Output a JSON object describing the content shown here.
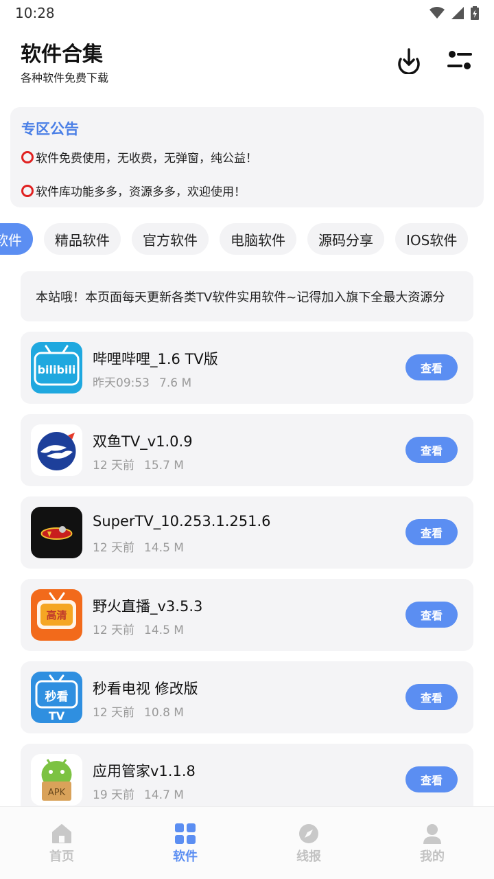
{
  "status_bar": {
    "time": "10:28"
  },
  "header": {
    "title": "软件合集",
    "subtitle": "各种软件免费下载"
  },
  "notice": {
    "title": "专区公告",
    "lines": [
      "软件免费使用，无收费，无弹窗，纯公益！",
      "软件库功能多多，资源多多，欢迎使用！"
    ]
  },
  "tabs": [
    "视软件",
    "精品软件",
    "官方软件",
    "电脑软件",
    "源码分享",
    "IOS软件"
  ],
  "marquee": {
    "text": "本站哦！本页面每天更新各类TV软件实用软件~记得加入旗下全最大资源分"
  },
  "apps": [
    {
      "name": "哔哩哔哩_1.6 TV版",
      "date": "昨天09:53",
      "size": "7.6 M",
      "button": "查看",
      "icon_text": "bilibili"
    },
    {
      "name": "双鱼TV_v1.0.9",
      "date": "12 天前",
      "size": "15.7 M",
      "button": "查看"
    },
    {
      "name": "SuperTV_10.253.1.251.6",
      "date": "12 天前",
      "size": "14.5 M",
      "button": "查看"
    },
    {
      "name": "野火直播_v3.5.3",
      "date": "12 天前",
      "size": "14.5 M",
      "button": "查看",
      "icon_text": "高清"
    },
    {
      "name": "秒看电视 修改版",
      "date": "12 天前",
      "size": "10.8 M",
      "button": "查看",
      "icon_text": "秒看",
      "icon_text2": "TV"
    },
    {
      "name": "应用管家v1.1.8",
      "date": "19 天前",
      "size": "14.7 M",
      "button": "查看",
      "icon_text": "APK"
    }
  ],
  "bottom_nav": [
    {
      "label": "首页",
      "icon": "home-icon"
    },
    {
      "label": "软件",
      "icon": "grid-icon"
    },
    {
      "label": "线报",
      "icon": "compass-icon"
    },
    {
      "label": "我的",
      "icon": "user-icon"
    }
  ],
  "colors": {
    "accent": "#5b8ef2",
    "notice_title": "#4a7fe6",
    "card_bg": "#f4f4f6"
  }
}
